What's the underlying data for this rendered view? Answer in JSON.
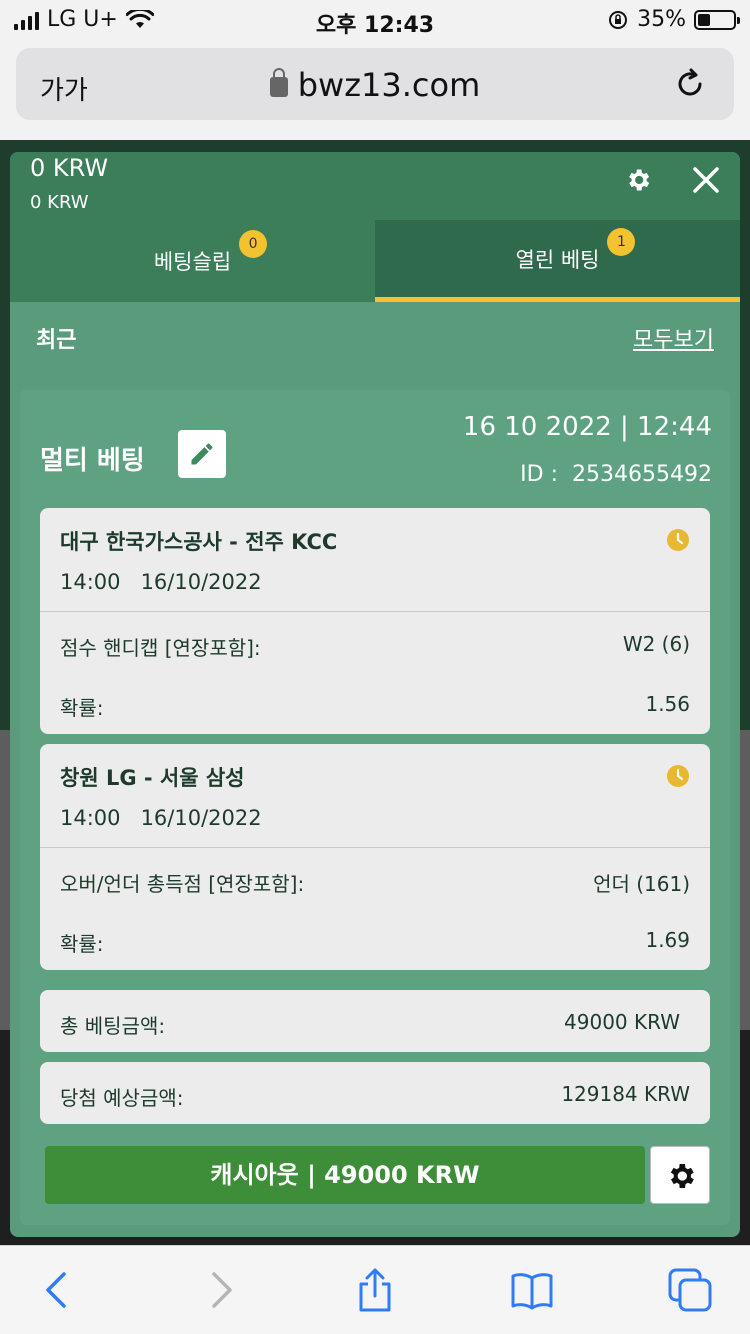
{
  "status_bar": {
    "carrier": "LG U+",
    "time": "오후 12:43",
    "battery_percent": "35%",
    "battery_level": 0.35
  },
  "browser": {
    "text_size_label": "가가",
    "url": "bwz13.com"
  },
  "panel": {
    "balance_main": "0 KRW",
    "balance_sub": "0 KRW",
    "tabs": [
      {
        "label": "베팅슬립",
        "badge": "0",
        "active": false
      },
      {
        "label": "열린 베팅",
        "badge": "1",
        "active": true
      }
    ],
    "recent_title": "최근",
    "see_all_label": "모두보기"
  },
  "bet": {
    "title": "멀티 베팅",
    "datetime": "16 10 2022 | 12:44",
    "id_label": "ID :",
    "id_value": "2534655492",
    "events": [
      {
        "name": "대구 한국가스공사 - 전주 KCC",
        "time": "14:00",
        "date": "16/10/2022",
        "market_label": "점수 핸디캡 [연장포함]:",
        "market_value": "W2 (6)",
        "odds_label": "확률:",
        "odds_value": "1.56"
      },
      {
        "name": "창원 LG - 서울 삼성",
        "time": "14:00",
        "date": "16/10/2022",
        "market_label": "오버/언더 총득점 [연장포함]:",
        "market_value": "언더 (161)",
        "odds_label": "확률:",
        "odds_value": "1.69"
      }
    ],
    "total_stake_label": "총 베팅금액:",
    "total_stake_value": "49000 KRW",
    "expected_win_label": "당첨 예상금액:",
    "expected_win_value": "129184 KRW",
    "cashout_label": "캐시아웃 | 49000 KRW"
  },
  "colors": {
    "panel_bg": "#5a9b7b",
    "header_bg": "#3c7d5a",
    "tab_active_bg": "#2f6a4c",
    "accent_yellow": "#f2c230",
    "cashout_green": "#3e8d38",
    "ios_blue": "#2f7cf6"
  },
  "icons": {
    "settings": "gear-icon",
    "close": "close-icon",
    "edit": "pencil-icon",
    "clock": "clock-icon",
    "back": "chevron-left-icon",
    "forward": "chevron-right-icon",
    "share": "share-icon",
    "bookmarks": "book-icon",
    "tabs": "tabs-icon"
  }
}
